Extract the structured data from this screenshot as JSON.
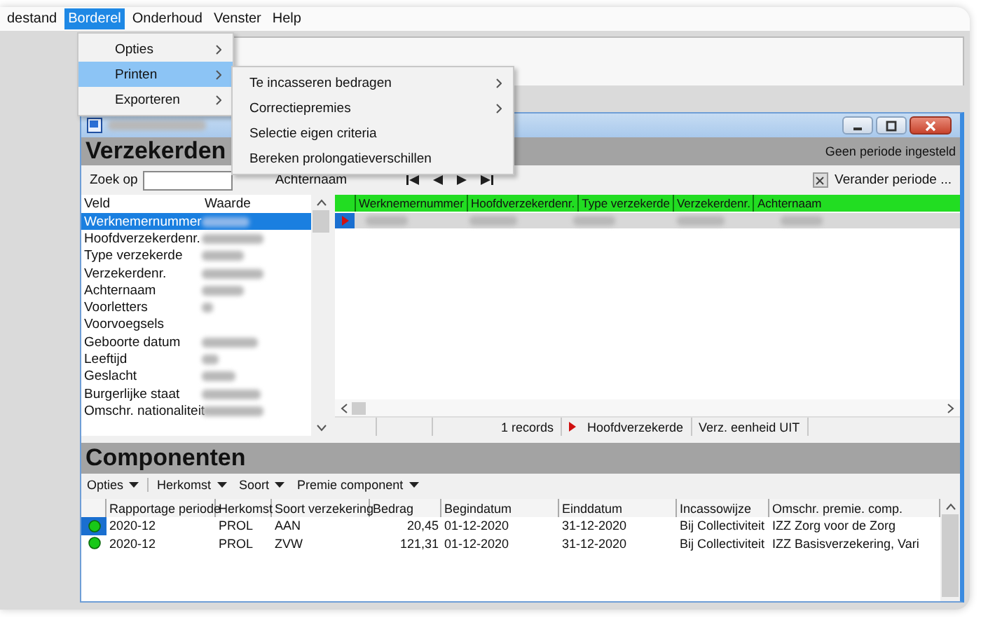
{
  "menu_bar": [
    {
      "label": "destand",
      "selected": false
    },
    {
      "label": "Borderel",
      "selected": true
    },
    {
      "label": "Onderhoud",
      "selected": false
    },
    {
      "label": "Venster",
      "selected": false
    },
    {
      "label": "Help",
      "selected": false
    }
  ],
  "menu": [
    {
      "label": "Opties",
      "has_submenu": true,
      "selected": false
    },
    {
      "label": "Printen",
      "has_submenu": true,
      "selected": true
    },
    {
      "label": "Exporteren",
      "has_submenu": true,
      "selected": false
    }
  ],
  "submenu": [
    {
      "label": "Te incasseren bedragen",
      "has_submenu": true
    },
    {
      "label": "Correctiepremies",
      "has_submenu": true
    },
    {
      "label": "Selectie eigen criteria",
      "has_submenu": false
    },
    {
      "label": "Bereken prolongatieverschillen",
      "has_submenu": false
    }
  ],
  "verzekerden": {
    "title": "Verzekerden",
    "period_status": "Geen periode ingesteld",
    "search_label": "Zoek op",
    "sort_label": "Achternaam",
    "period_button": "Verander periode ...",
    "field_list": {
      "columns": [
        "Veld",
        "Waarde"
      ],
      "rows": [
        {
          "label": "Werknemernummer",
          "selected": true
        },
        {
          "label": "Hoofdverzekerdenr.",
          "selected": false
        },
        {
          "label": "Type verzekerde",
          "selected": false
        },
        {
          "label": "Verzekerdenr.",
          "selected": false
        },
        {
          "label": "Achternaam",
          "selected": false
        },
        {
          "label": "Voorletters",
          "selected": false
        },
        {
          "label": "Voorvoegsels",
          "selected": false
        },
        {
          "label": "Geboorte datum",
          "selected": false
        },
        {
          "label": "Leeftijd",
          "selected": false
        },
        {
          "label": "Geslacht",
          "selected": false
        },
        {
          "label": "Burgerlijke staat",
          "selected": false
        },
        {
          "label": "Omschr. nationaliteit",
          "selected": false
        }
      ]
    },
    "grid": {
      "columns": [
        "Werknemernummer",
        "Hoofdverzekerdenr.",
        "Type verzekerde",
        "Verzekerdenr.",
        "Achternaam"
      ],
      "records": [
        {
          "selected": true
        }
      ]
    },
    "status": {
      "count": "1 records",
      "role": "Hoofdverzekerde",
      "unit": "Verz. eenheid UIT"
    }
  },
  "componenten": {
    "title": "Componenten",
    "toolbar": [
      "Opties",
      "Herkomst",
      "Soort",
      "Premie component"
    ],
    "columns": [
      "Rapportage periode",
      "Herkomst",
      "Soort verzekering",
      "Bedrag",
      "Begindatum",
      "Einddatum",
      "Incassowijze",
      "Omschr. premie. comp."
    ],
    "rows": [
      {
        "selected": true,
        "cells": [
          "2020-12",
          "PROL",
          "AAN",
          "20,45",
          "01-12-2020",
          "31-12-2020",
          "Bij Collectiviteit",
          "IZZ Zorg voor de Zorg"
        ]
      },
      {
        "selected": false,
        "cells": [
          "2020-12",
          "PROL",
          "ZVW",
          "121,31",
          "01-12-2020",
          "31-12-2020",
          "Bij Collectiviteit",
          "IZZ Basisverzekering, Vari"
        ]
      }
    ]
  }
}
